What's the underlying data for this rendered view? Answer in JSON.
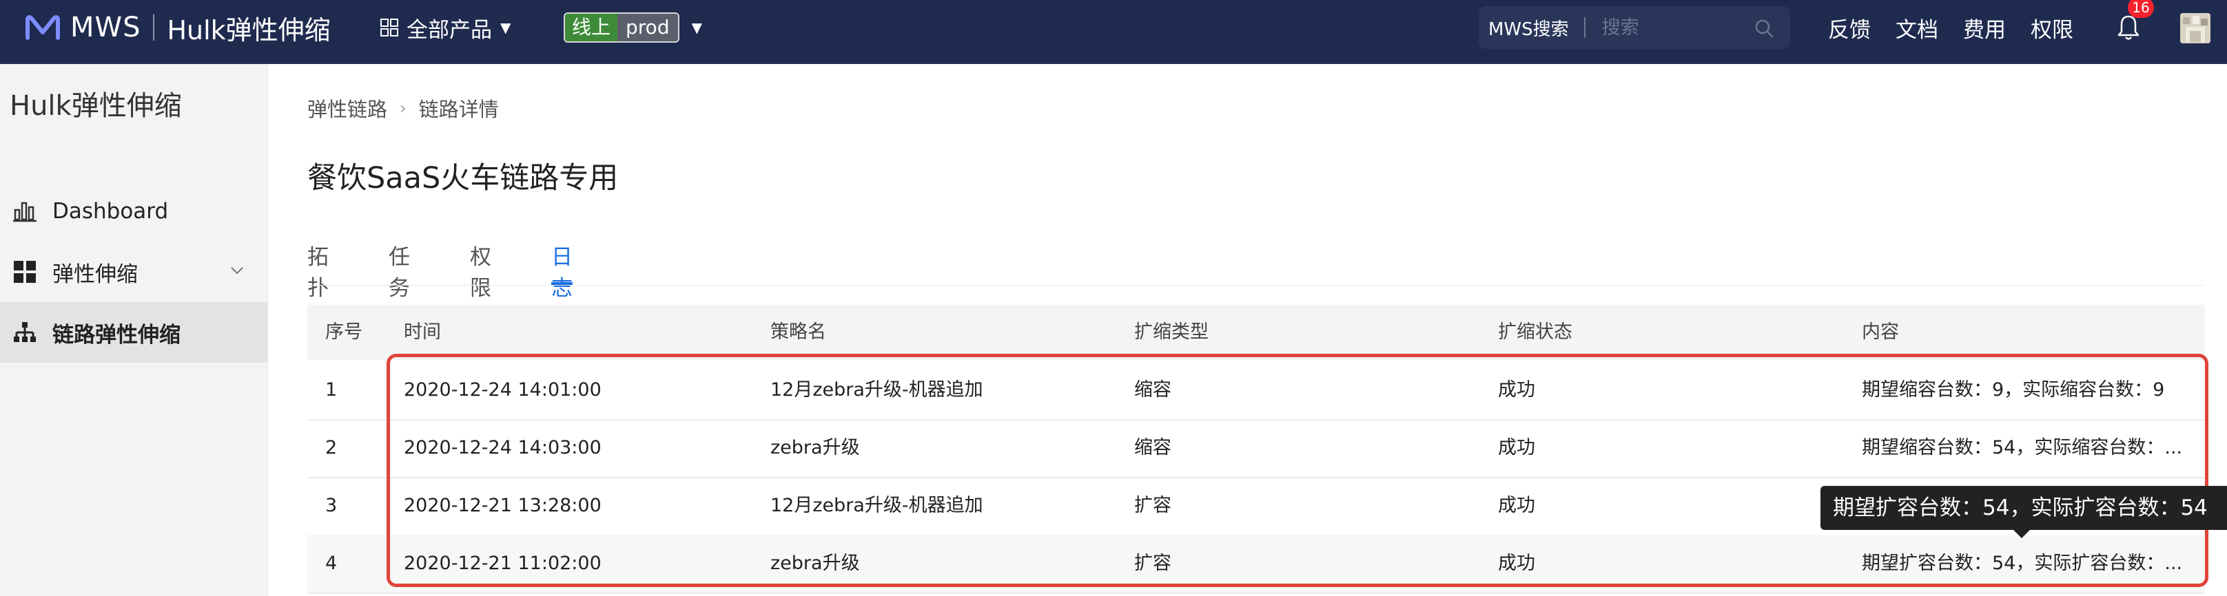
{
  "topbar": {
    "brand": "MWS",
    "product": "Hulk弹性伸缩",
    "all_products": "全部产品",
    "env_online": "线上",
    "env_prod": "prod",
    "search_label": "MWS搜索",
    "search_placeholder": "搜索",
    "nav": [
      "反馈",
      "文档",
      "费用",
      "权限"
    ],
    "notification_count": "16",
    "bg_color": "#1f2a4f"
  },
  "sidebar": {
    "title": "Hulk弹性伸缩",
    "items": [
      {
        "label": "Dashboard",
        "icon": "bar-chart-icon"
      },
      {
        "label": "弹性伸缩",
        "icon": "grid-icon"
      },
      {
        "label": "链路弹性伸缩",
        "icon": "sitemap-icon"
      }
    ]
  },
  "breadcrumb": {
    "parent": "弹性链路",
    "current": "链路详情"
  },
  "page_title": "餐饮SaaS火车链路专用",
  "tabs": [
    "拓扑",
    "任务",
    "权限",
    "日志"
  ],
  "active_tab": "日志",
  "table": {
    "columns": [
      "序号",
      "时间",
      "策略名",
      "扩缩类型",
      "扩缩状态",
      "内容"
    ],
    "rows": [
      {
        "no": "1",
        "time": "2020-12-24 14:01:00",
        "policy": "12月zebra升级-机器追加",
        "type": "缩容",
        "status": "成功",
        "content": "期望缩容台数：9，实际缩容台数：9"
      },
      {
        "no": "2",
        "time": "2020-12-24 14:03:00",
        "policy": "zebra升级",
        "type": "缩容",
        "status": "成功",
        "content": "期望缩容台数：54，实际缩容台数：..."
      },
      {
        "no": "3",
        "time": "2020-12-21 13:28:00",
        "policy": "12月zebra升级-机器追加",
        "type": "扩容",
        "status": "成功",
        "content": ""
      },
      {
        "no": "4",
        "time": "2020-12-21 11:02:00",
        "policy": "zebra升级",
        "type": "扩容",
        "status": "成功",
        "content": "期望扩容台数：54，实际扩容台数：..."
      }
    ]
  },
  "tooltip": "期望扩容台数：54，实际扩容台数：54",
  "colors": {
    "accent": "#1b6fe0",
    "highlight": "#e0443a",
    "env_online": "#3d8b38"
  }
}
